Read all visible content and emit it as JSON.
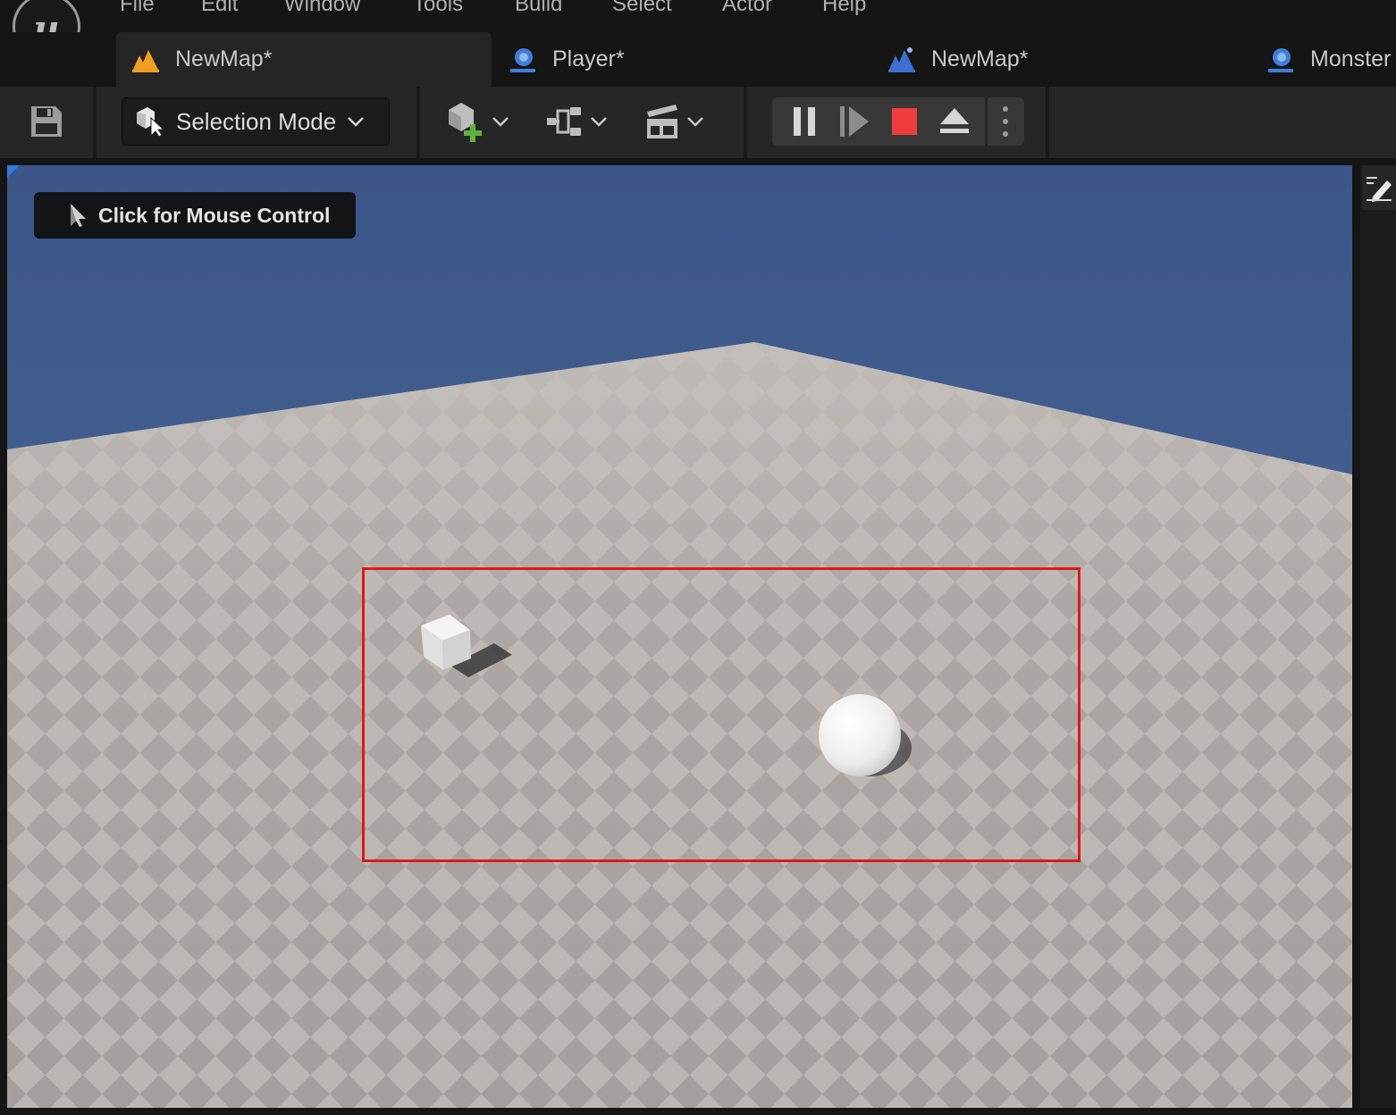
{
  "menu": {
    "items": [
      "File",
      "Edit",
      "Window",
      "Tools",
      "Build",
      "Select",
      "Actor",
      "Help"
    ]
  },
  "logo": {
    "icon": "unreal-engine-logo-icon",
    "glyph": "u"
  },
  "tabs": [
    {
      "label": "NewMap*",
      "icon": "level-map-icon",
      "active": true
    },
    {
      "label": "Player*",
      "icon": "blueprint-icon",
      "active": false
    },
    {
      "label": "NewMap*",
      "icon": "level-map-blue-icon",
      "active": false
    },
    {
      "label": "Monster",
      "icon": "blueprint-icon",
      "active": false
    }
  ],
  "toolbar": {
    "save_icon": "save-icon",
    "selection_mode": "Selection Mode",
    "add_actor_icon": "add-actor-icon",
    "blueprint_menu_icon": "blueprint-graph-icon",
    "cinematics_icon": "clapperboard-icon",
    "play_controls": [
      "pause-icon",
      "advance-frame-icon",
      "stop-icon",
      "eject-icon",
      "more-options-icon"
    ]
  },
  "viewport": {
    "mouse_control_label": "Click for Mouse Control",
    "colors": {
      "sky": "#46628e",
      "floor_light": "#bcb6b3",
      "floor_dark": "#a49e9c",
      "selection": "#e01818"
    }
  },
  "right_panel": {
    "icon": "edit-pencil-icon"
  }
}
